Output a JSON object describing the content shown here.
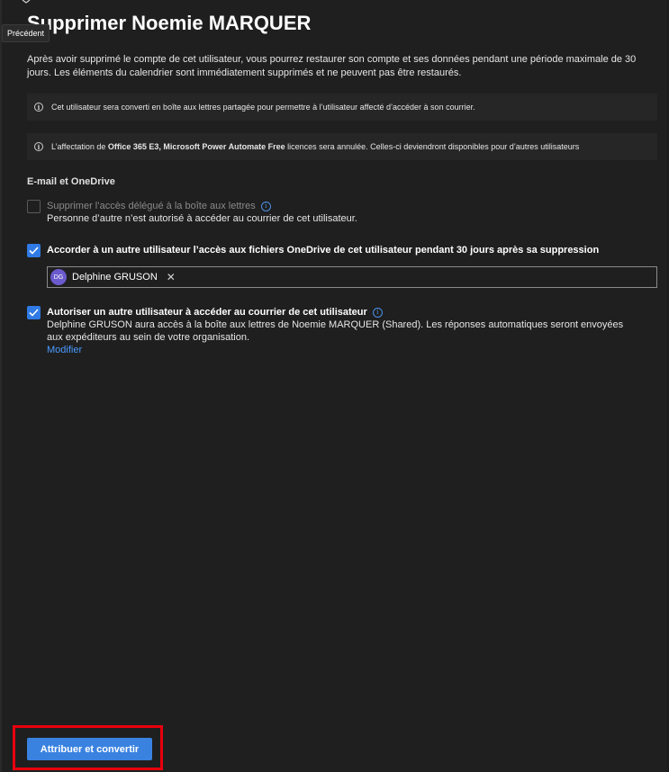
{
  "tooltip": "Précédent",
  "title": "Supprimer Noemie MARQUER",
  "intro": "Après avoir supprimé le compte de cet utilisateur, vous pourrez restaurer son compte et ses données pendant une période maximale de 30 jours. Les éléments du calendrier sont immédiatement supprimés et ne peuvent pas être restaurés.",
  "info1": {
    "text": "Cet utilisateur sera converti en boîte aux lettres partagée pour permettre à l’utilisateur affecté d’accéder à son courrier."
  },
  "info2": {
    "prefix": "L’affectation de ",
    "licenses": "Office 365 E3, Microsoft Power Automate Free",
    "suffix": " licences sera annulée. Celles-ci deviendront disponibles pour d’autres utilisateurs"
  },
  "section_title": "E-mail et OneDrive",
  "option1": {
    "label": "Supprimer l’accès délégué à la boîte aux lettres",
    "desc": "Personne d’autre n’est autorisé à accéder au courrier de cet utilisateur.",
    "checked": false,
    "disabled": true
  },
  "option2": {
    "label": "Accorder à un autre utilisateur l’accès aux fichiers OneDrive de cet utilisateur pendant 30 jours après sa suppression",
    "checked": true
  },
  "people_picker": {
    "initials": "DG",
    "name": "Delphine GRUSON"
  },
  "option3": {
    "label": "Autoriser un autre utilisateur à accéder au courrier de cet utilisateur",
    "desc": "Delphine GRUSON aura accès à la boîte aux lettres de Noemie MARQUER (Shared). Les réponses automatiques seront envoyées aux expéditeurs au sein de votre organisation.",
    "link": "Modifier",
    "checked": true
  },
  "footer": {
    "primary_label": "Attribuer et convertir"
  },
  "colors": {
    "accent": "#3a82e0",
    "highlight": "#e8000d",
    "background": "#1f1f1f"
  }
}
